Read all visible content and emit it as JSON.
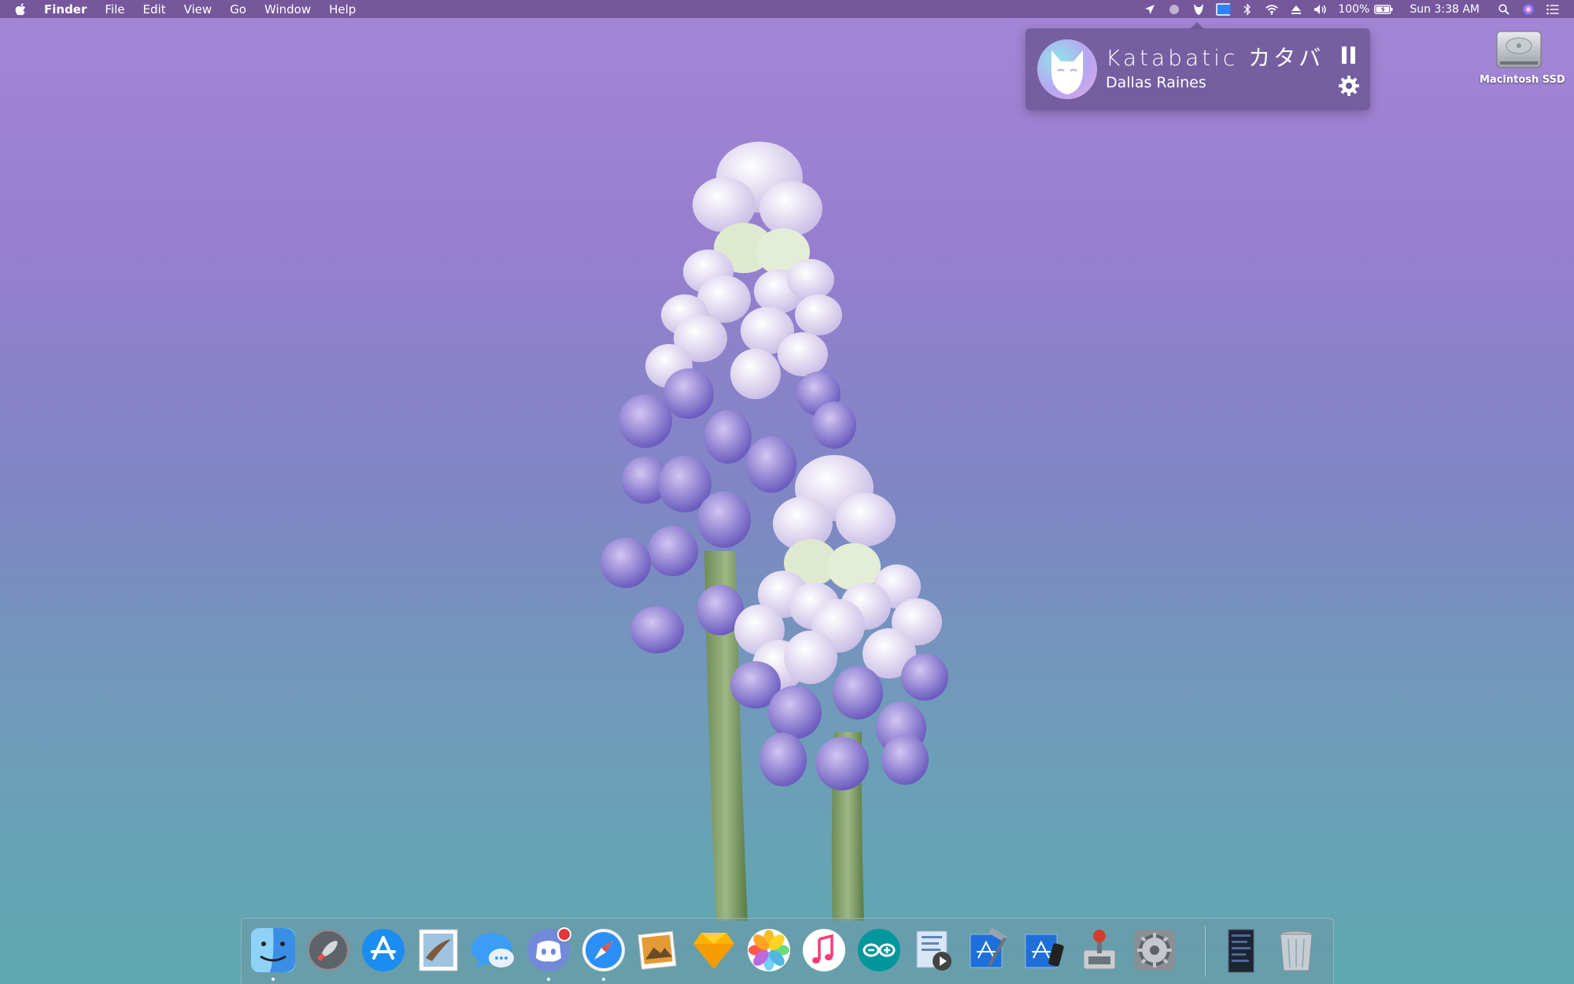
{
  "menubar": {
    "app_name": "Finder",
    "menus": [
      "File",
      "Edit",
      "View",
      "Go",
      "Window",
      "Help"
    ],
    "battery": "100%",
    "clock": "Sun 3:38 AM",
    "status_icons": [
      "location-icon",
      "circle-status-icon",
      "katabatic-fox-icon",
      "display-icon",
      "bluetooth-icon",
      "wifi-icon",
      "eject-icon",
      "volume-icon",
      "battery-icon",
      "spotlight-icon",
      "siri-icon",
      "notification-center-icon"
    ]
  },
  "now_playing": {
    "title": "Katabatic カタバ",
    "artist": "Dallas Raines",
    "controls": [
      "pause-icon",
      "gear-icon"
    ]
  },
  "desktop": {
    "drive_label": "Macintosh SSD"
  },
  "dock": {
    "apps": [
      {
        "name": "finder",
        "icon": "finder-icon",
        "running": true
      },
      {
        "name": "launchpad",
        "icon": "rocket-icon",
        "running": false
      },
      {
        "name": "app-store",
        "icon": "app-store-icon",
        "running": false
      },
      {
        "name": "mail",
        "icon": "mail-stamp-icon",
        "running": false
      },
      {
        "name": "messages",
        "icon": "messages-icon",
        "running": false
      },
      {
        "name": "discord",
        "icon": "discord-icon",
        "running": true,
        "badge": true
      },
      {
        "name": "safari",
        "icon": "compass-icon",
        "running": true
      },
      {
        "name": "preview",
        "icon": "preview-icon",
        "running": false
      },
      {
        "name": "sketch",
        "icon": "sketch-diamond-icon",
        "running": false
      },
      {
        "name": "photos",
        "icon": "photos-icon",
        "running": false
      },
      {
        "name": "itunes",
        "icon": "music-note-icon",
        "running": false
      },
      {
        "name": "arduino",
        "icon": "arduino-icon",
        "running": false
      },
      {
        "name": "script-editor",
        "icon": "script-play-icon",
        "running": false
      },
      {
        "name": "xcode",
        "icon": "xcode-hammer-icon",
        "running": false
      },
      {
        "name": "simulator",
        "icon": "simulator-icon",
        "running": false
      },
      {
        "name": "server-app",
        "icon": "joystick-icon",
        "running": false
      },
      {
        "name": "system-preferences",
        "icon": "gear-icon",
        "running": false
      },
      {
        "name": "stack-folder",
        "icon": "document-stack-icon",
        "running": false
      },
      {
        "name": "trash",
        "icon": "trash-icon",
        "running": false
      }
    ]
  },
  "colors": {
    "menubar_bg": "#50326e",
    "accent_blue": "#2e84f6",
    "badge_red": "#e3353a"
  }
}
